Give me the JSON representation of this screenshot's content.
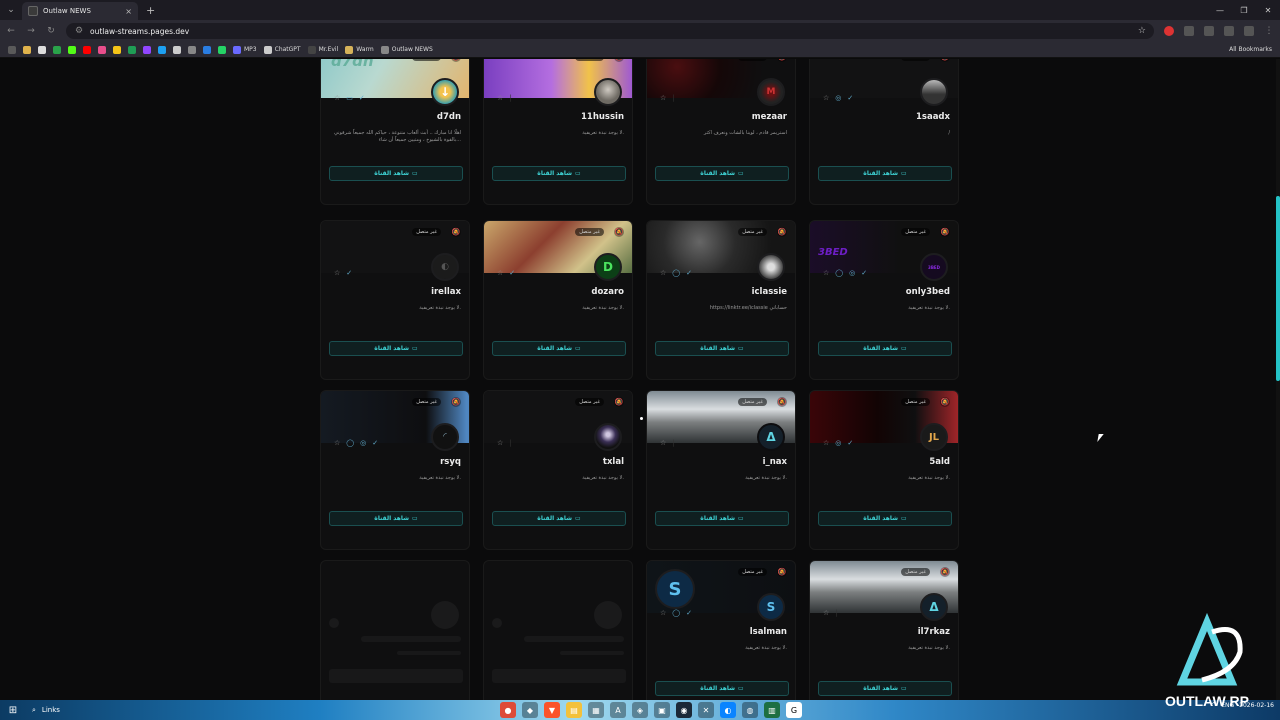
{
  "browser": {
    "tab_title": "Outlaw NEWS",
    "tab_close": "×",
    "new_tab": "+",
    "url": "outlaw-streams.pages.dev",
    "bookmarks": [
      {
        "label": "MP3",
        "color": "#6a6aff"
      },
      {
        "label": "ChatGPT",
        "color": "#cccccc"
      },
      {
        "label": "Mr.Evil",
        "color": "#444444"
      },
      {
        "label": "Warm",
        "color": "#d6b35a"
      },
      {
        "label": "Outlaw NEWS",
        "color": "#888888"
      }
    ],
    "all_bookmarks": "All Bookmarks"
  },
  "watch_label": "شاهد القناة",
  "live_label": "غير متصل",
  "cards": [
    {
      "name": "d7dn",
      "desc": "اهلًا انا مبارك .. أبث ألعاب متنوعة ، حياكم الله جميعاً شرفوني بالقوة بالشيوخ ، ومتيين جميعاً أن شاء...",
      "banner_text": "d7dn",
      "avatar_glyph": "↓"
    },
    {
      "name": "11hussin",
      "desc": "لا يوجد نبذة تعريفية.",
      "banner_text": "",
      "avatar_glyph": ""
    },
    {
      "name": "mezaar",
      "desc": "استريمر قادم ، لوينا بالشات ونعرف اكثر",
      "banner_text": "",
      "avatar_glyph": "M"
    },
    {
      "name": "1saadx",
      "desc": "/",
      "banner_text": "",
      "avatar_glyph": ""
    },
    {
      "name": "irellax",
      "desc": "لا يوجد نبذة تعريفية.",
      "banner_text": "",
      "avatar_glyph": "◐"
    },
    {
      "name": "dozaro",
      "desc": "لا يوجد نبذة تعريفية.",
      "banner_text": "",
      "avatar_glyph": "D"
    },
    {
      "name": "iclassie",
      "desc": "https://linktr.ee/iclassie حساباتي",
      "banner_text": "",
      "avatar_glyph": ""
    },
    {
      "name": "only3bed",
      "desc": "لا يوجد نبذة تعريفية.",
      "banner_text": "3BED",
      "avatar_glyph": "3BED"
    },
    {
      "name": "rsyq",
      "desc": "لا يوجد نبذة تعريفية.",
      "banner_text": "",
      "avatar_glyph": "◜"
    },
    {
      "name": "txlal",
      "desc": "لا يوجد نبذة تعريفية.",
      "banner_text": "",
      "avatar_glyph": ""
    },
    {
      "name": "i_nax",
      "desc": "لا يوجد نبذة تعريفية.",
      "banner_text": "",
      "avatar_glyph": "Δ"
    },
    {
      "name": "5ald",
      "desc": "لا يوجد نبذة تعريفية.",
      "banner_text": "",
      "avatar_glyph": "JL"
    },
    {
      "name": "lsalman",
      "desc": "لا يوجد نبذة تعريفية.",
      "banner_text": "",
      "avatar_glyph": "S"
    },
    {
      "name": "il7rkaz",
      "desc": "لا يوجد نبذة تعريفية.",
      "banner_text": "",
      "avatar_glyph": "Δ"
    }
  ],
  "taskbar": {
    "search_label": "Links",
    "tray_lang": "ENG",
    "tray_time": "2026-02-16"
  },
  "overlay_logo": "OUTLAW RP"
}
